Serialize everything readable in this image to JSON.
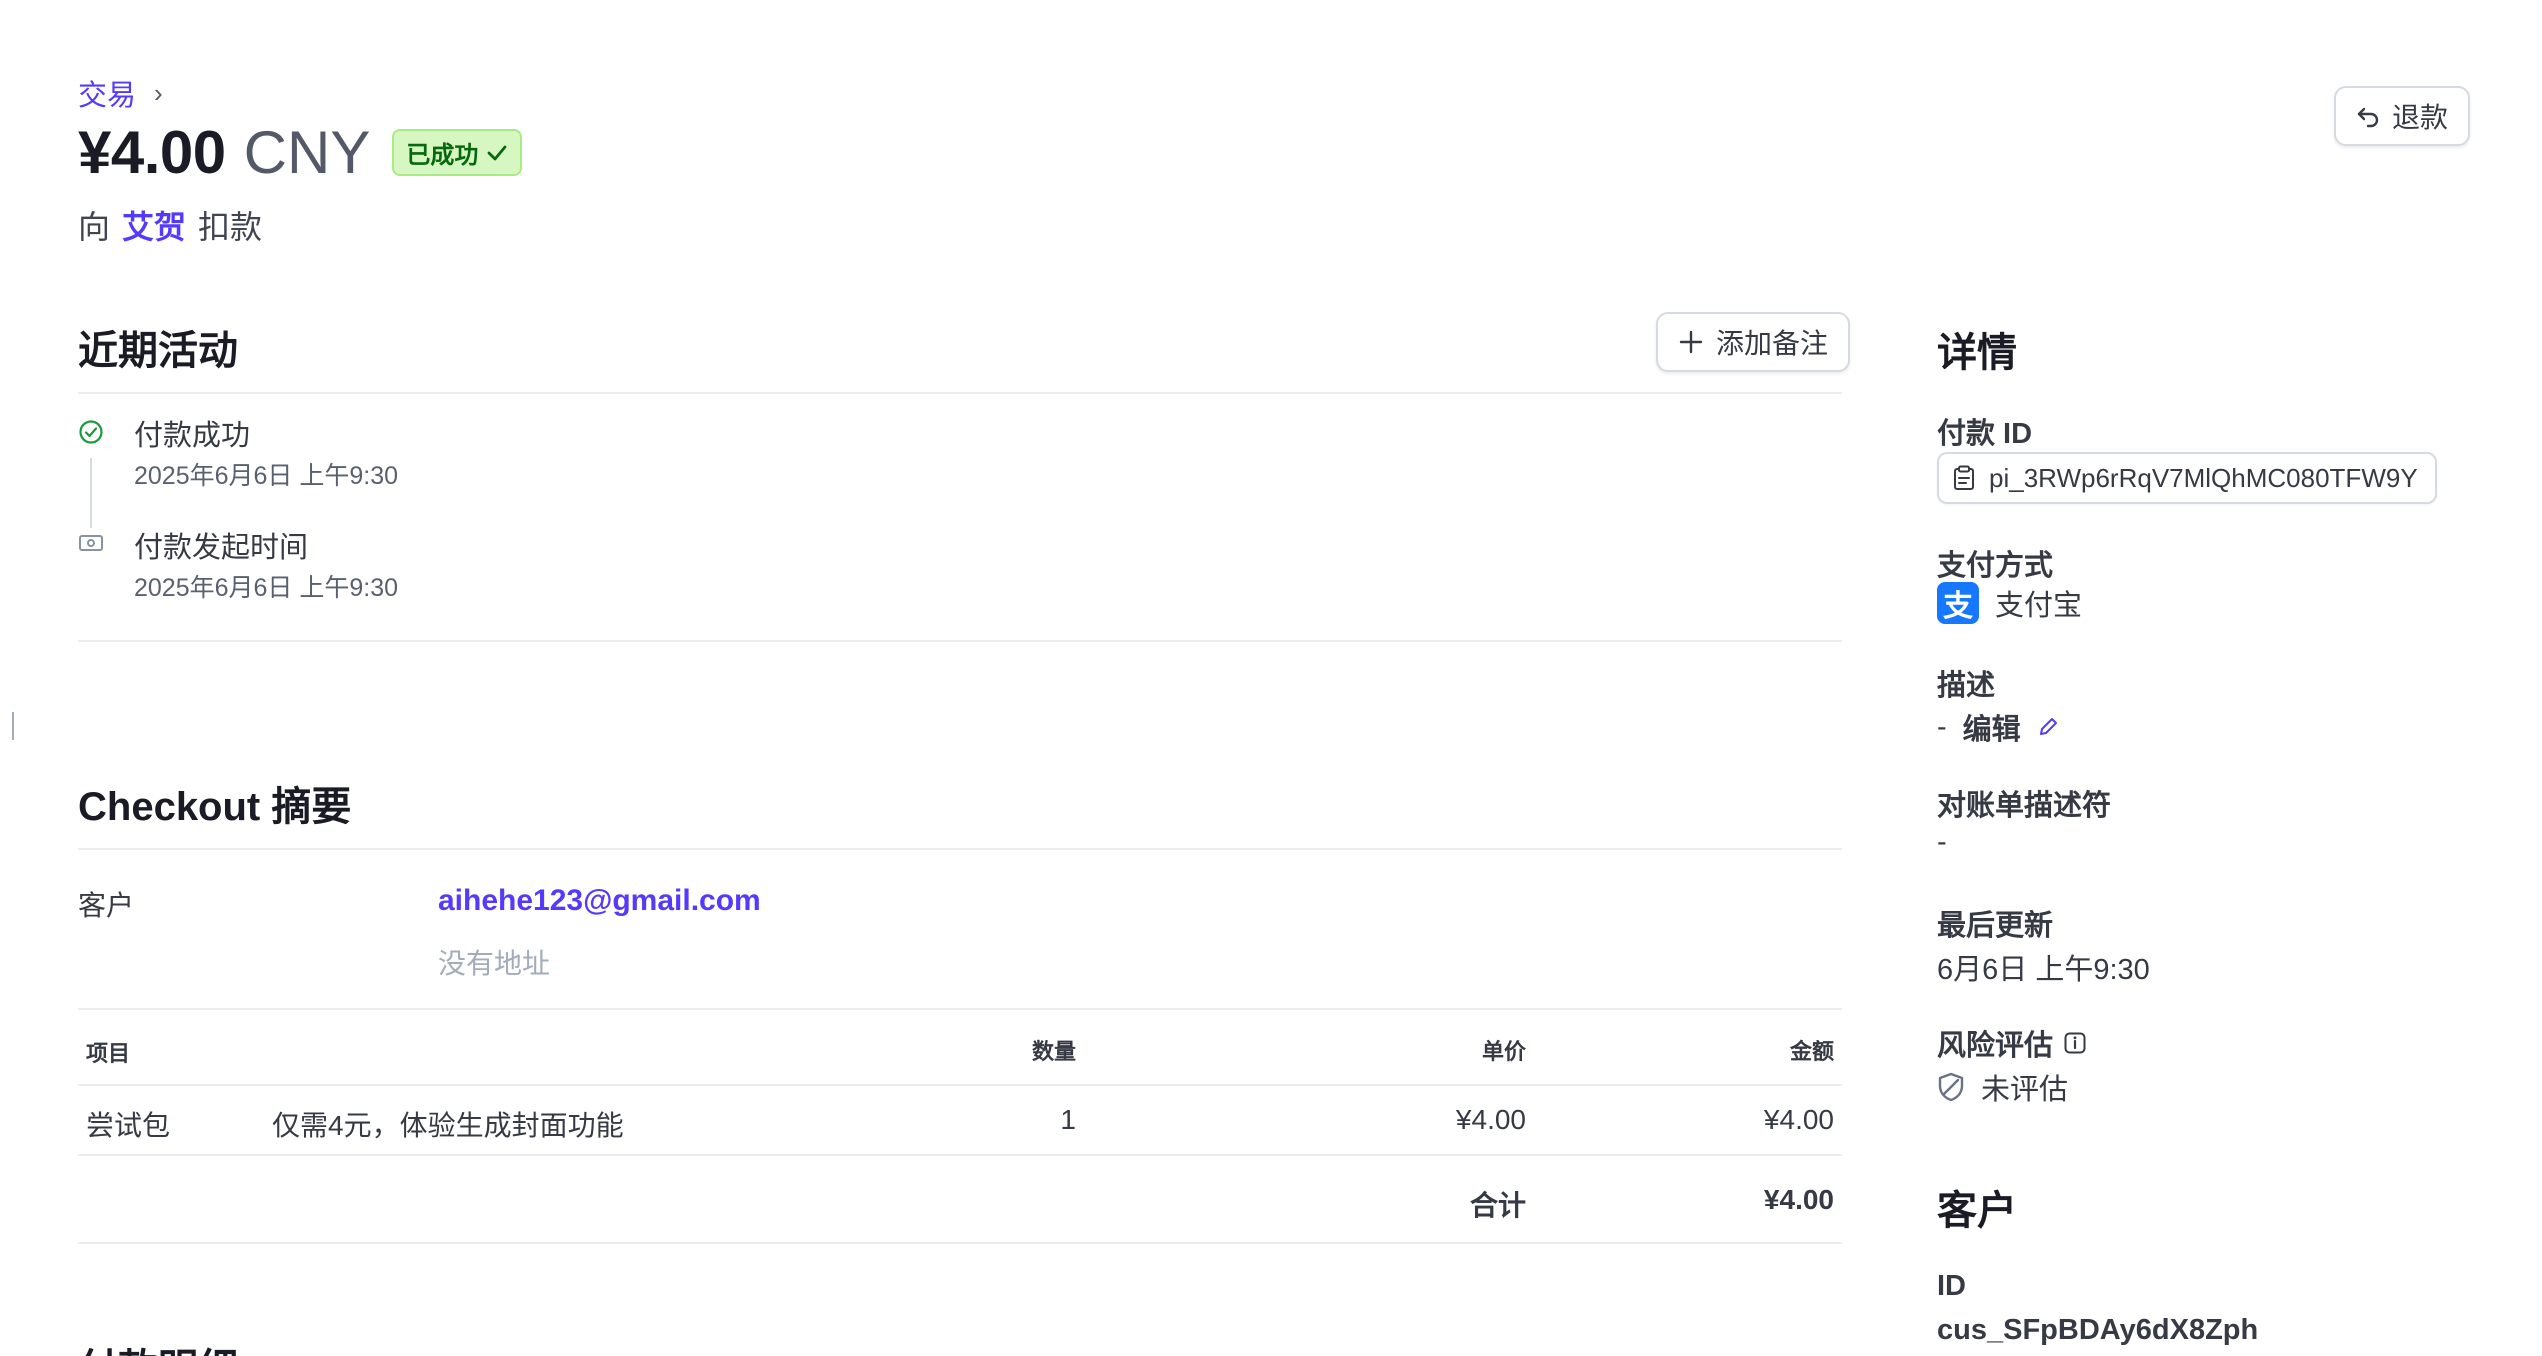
{
  "breadcrumb": {
    "label": "交易",
    "chevron": "›"
  },
  "header": {
    "amount": "¥4.00",
    "currency": "CNY",
    "status_badge": "已成功",
    "charge_prefix": "向",
    "customer_name": "艾贺",
    "charge_suffix": "扣款",
    "refund_button": "退款"
  },
  "activity": {
    "title": "近期活动",
    "add_note_button": "添加备注",
    "events": [
      {
        "title": "付款成功",
        "time": "2025年6月6日 上午9:30",
        "icon": "check-circle-icon"
      },
      {
        "title": "付款发起时间",
        "time": "2025年6月6日 上午9:30",
        "icon": "payment-icon"
      }
    ]
  },
  "checkout": {
    "title": "Checkout 摘要",
    "customer_label": "客户",
    "customer_email": "aihehe123@gmail.com",
    "customer_address": "没有地址",
    "columns": {
      "item": "项目",
      "qty": "数量",
      "unit_price": "单价",
      "amount": "金额"
    },
    "items": [
      {
        "name": "尝试包",
        "description": "仅需4元，体验生成封面功能",
        "qty": "1",
        "unit_price": "¥4.00",
        "amount": "¥4.00"
      }
    ],
    "total_label": "合计",
    "total_value": "¥4.00",
    "next_section_partial": "付款明细"
  },
  "details": {
    "title": "详情",
    "payment_id_label": "付款 ID",
    "payment_id": "pi_3RWp6rRqV7MlQhMC080TFW9Y",
    "payment_method_label": "支付方式",
    "payment_method": "支付宝",
    "description_label": "描述",
    "description_value": "-",
    "description_edit": "编辑",
    "statement_descriptor_label": "对账单描述符",
    "statement_descriptor_value": "-",
    "last_updated_label": "最后更新",
    "last_updated_value": "6月6日 上午9:30",
    "risk_label": "风险评估",
    "risk_value": "未评估"
  },
  "customer": {
    "title": "客户",
    "id_label": "ID",
    "id_value": "cus_SFpBDAy6dX8Zph"
  },
  "colors": {
    "accent": "#533afd",
    "success_bg": "#d7f7c2",
    "success_text": "#05690d",
    "alipay_blue": "#1677ff"
  }
}
